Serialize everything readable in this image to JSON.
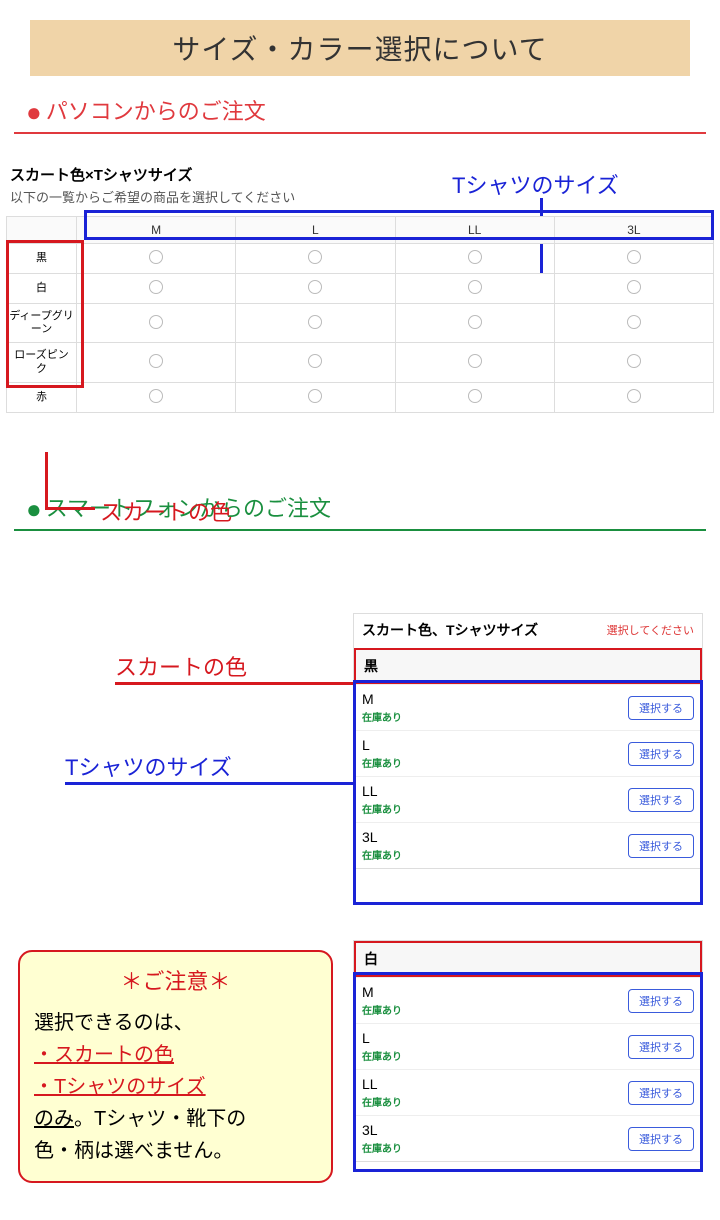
{
  "title": "サイズ・カラー選択について",
  "sections": {
    "pc": "パソコンからのご注文",
    "sp": "スマートフォンからのご注文"
  },
  "callouts": {
    "tshirt_size": "Tシャツのサイズ",
    "skirt_color": "スカートの色"
  },
  "pc_table": {
    "heading": "スカート色×Tシャツサイズ",
    "sub": "以下の一覧からご希望の商品を選択してください",
    "sizes": [
      "M",
      "L",
      "LL",
      "3L"
    ],
    "colors": [
      "黒",
      "白",
      "ディープグリーン",
      "ローズピンク",
      "赤"
    ]
  },
  "sp": {
    "title": "スカート色、Tシャツサイズ",
    "please": "選択してください",
    "stock": "在庫あり",
    "select": "選択する",
    "groups": [
      {
        "color": "黒",
        "sizes": [
          "M",
          "L",
          "LL",
          "3L"
        ]
      },
      {
        "color": "白",
        "sizes": [
          "M",
          "L",
          "LL",
          "3L"
        ]
      }
    ]
  },
  "caution": {
    "title": "＊ご注意＊",
    "line1": "選択できるのは、",
    "opt1": "・スカートの色",
    "opt2": "・Tシャツのサイズ",
    "line2a": "のみ",
    "line2b": "。Tシャツ・靴下の",
    "line3": "色・柄は選べません。"
  }
}
